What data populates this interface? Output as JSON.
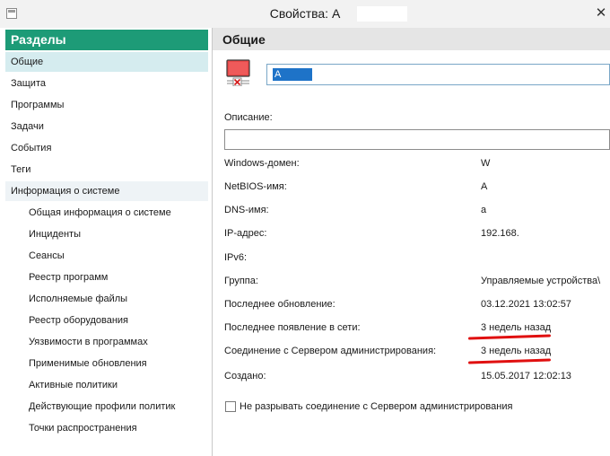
{
  "window": {
    "title": "Свойства: А",
    "close_glyph": "✕"
  },
  "sidebar": {
    "header": "Разделы",
    "items": [
      {
        "label": "Общие"
      },
      {
        "label": "Защита"
      },
      {
        "label": "Программы"
      },
      {
        "label": "Задачи"
      },
      {
        "label": "События"
      },
      {
        "label": "Теги"
      },
      {
        "label": "Информация о системе"
      }
    ],
    "subitems": [
      {
        "label": "Общая информация о системе"
      },
      {
        "label": "Инциденты"
      },
      {
        "label": "Сеансы"
      },
      {
        "label": "Реестр программ"
      },
      {
        "label": "Исполняемые файлы"
      },
      {
        "label": "Реестр оборудования"
      },
      {
        "label": "Уязвимости в программах"
      },
      {
        "label": "Применимые обновления"
      },
      {
        "label": "Активные политики"
      },
      {
        "label": "Действующие профили политик"
      },
      {
        "label": "Точки распространения"
      }
    ]
  },
  "main": {
    "title": "Общие",
    "name_value": "А",
    "description_label": "Описание:",
    "description_value": "",
    "properties": [
      {
        "label": "Windows-домен:",
        "value": "W"
      },
      {
        "label": "NetBIOS-имя:",
        "value": "А"
      },
      {
        "label": "DNS-имя:",
        "value": "а"
      },
      {
        "label": "IP-адрес:",
        "value": "192.168."
      },
      {
        "label": "IPv6:",
        "value": ""
      },
      {
        "label": "Группа:",
        "value": "Управляемые устройства\\"
      },
      {
        "label": "Последнее обновление:",
        "value": "03.12.2021 13:02:57"
      },
      {
        "label": "Последнее появление в сети:",
        "value": "3 недель назад"
      },
      {
        "label": "Соединение с Сервером администрирования:",
        "value": "3 недель назад"
      },
      {
        "label": "Создано:",
        "value": "15.05.2017 12:02:13"
      }
    ],
    "checkbox_label": "Не разрывать соединение с Сервером администрирования",
    "checkbox_checked": false
  },
  "colors": {
    "accent": "#1d9b77",
    "selection": "#1e73c8",
    "annotation": "#e01010"
  },
  "icons": {
    "computer": "computer-disconnected-icon",
    "close": "close-icon"
  }
}
